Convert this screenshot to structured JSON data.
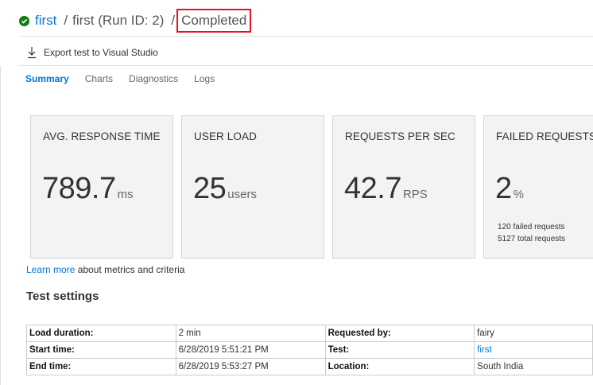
{
  "header": {
    "link_text": "first",
    "separator": "/",
    "run_label": "first (Run ID: 2)",
    "status": "Completed"
  },
  "toolbar": {
    "export_label": "Export test to Visual Studio"
  },
  "tabs": [
    {
      "label": "Summary",
      "active": true
    },
    {
      "label": "Charts",
      "active": false
    },
    {
      "label": "Diagnostics",
      "active": false
    },
    {
      "label": "Logs",
      "active": false
    }
  ],
  "metrics": {
    "response_time": {
      "title": "AVG. RESPONSE TIME",
      "value": "789.7",
      "unit": "ms"
    },
    "user_load": {
      "title": "USER LOAD",
      "value": "25",
      "unit": "users"
    },
    "rps": {
      "title": "REQUESTS PER SEC",
      "value": "42.7",
      "unit": "RPS"
    },
    "failed": {
      "title": "FAILED REQUESTS",
      "value": "2",
      "unit": "%",
      "sub1": "120 failed requests",
      "sub2": "5127 total requests"
    }
  },
  "learn_more": {
    "link": "Learn more",
    "rest": " about metrics and criteria"
  },
  "settings": {
    "title": "Test settings",
    "rows": [
      {
        "label1": "Load duration:",
        "value1": "2 min",
        "label2": "Requested by:",
        "value2": "fairy"
      },
      {
        "label1": "Start time:",
        "value1": "6/28/2019 5:51:21 PM",
        "label2": "Test:",
        "value2": "first"
      },
      {
        "label1": "End time:",
        "value1": "6/28/2019 5:53:27 PM",
        "label2": "Location:",
        "value2": "South India"
      }
    ]
  },
  "colors": {
    "accent": "#0078d4",
    "success": "#107c10",
    "highlight": "#e81123"
  }
}
